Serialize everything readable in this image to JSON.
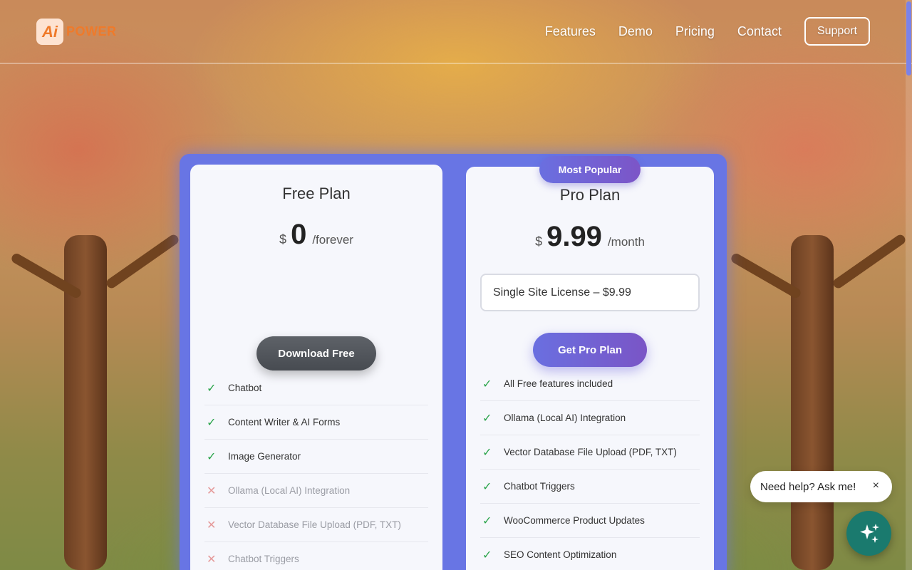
{
  "brand": {
    "logo_mark": "Ai",
    "name": "POWER",
    "accent": "#ef7a2a"
  },
  "nav": {
    "items": [
      {
        "label": "Features"
      },
      {
        "label": "Demo"
      },
      {
        "label": "Pricing"
      },
      {
        "label": "Contact"
      }
    ],
    "support_label": "Support"
  },
  "plans": {
    "free": {
      "title": "Free Plan",
      "currency": "$",
      "amount": "0",
      "period": "/forever",
      "button_label": "Download Free",
      "features": [
        {
          "text": "Chatbot",
          "included": true,
          "mark": "✓"
        },
        {
          "text": "Content Writer & AI Forms",
          "included": true,
          "mark": "✓"
        },
        {
          "text": "Image Generator",
          "included": true,
          "mark": "✓"
        },
        {
          "text": "Ollama (Local AI) Integration",
          "included": false,
          "mark": "✕"
        },
        {
          "text": "Vector Database File Upload (PDF, TXT)",
          "included": false,
          "mark": "✕"
        },
        {
          "text": "Chatbot Triggers",
          "included": false,
          "mark": "✕"
        }
      ]
    },
    "pro": {
      "badge": "Most Popular",
      "title": "Pro Plan",
      "currency": "$",
      "amount": "9.99",
      "period": "/month",
      "license_selected": "Single Site License – $9.99",
      "button_label": "Get Pro Plan",
      "features": [
        {
          "text": "All Free features included",
          "included": true,
          "mark": "✓"
        },
        {
          "text": "Ollama (Local AI) Integration",
          "included": true,
          "mark": "✓"
        },
        {
          "text": "Vector Database File Upload (PDF, TXT)",
          "included": true,
          "mark": "✓"
        },
        {
          "text": "Chatbot Triggers",
          "included": true,
          "mark": "✓"
        },
        {
          "text": "WooCommerce Product Updates",
          "included": true,
          "mark": "✓"
        },
        {
          "text": "SEO Content Optimization",
          "included": true,
          "mark": "✓"
        }
      ]
    }
  },
  "help": {
    "bubble_text": "Need help? Ask me!",
    "close_glyph": "×",
    "fab_icon": "sparkles-icon"
  },
  "colors": {
    "pricing_frame": "#6875e4",
    "check": "#2aa44a",
    "cross": "#e59a9a",
    "fab": "#1a7a6e"
  }
}
